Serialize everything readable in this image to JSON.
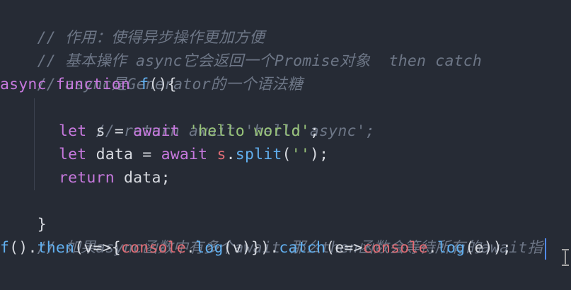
{
  "code": {
    "line1": {
      "comment": "// 作用：使得异步操作更加方便"
    },
    "line2": {
      "comment": "// 基本操作 async它会返回一个Promise对象  then catch"
    },
    "line3": {
      "comment": "// async是Generator的一个语法糖"
    },
    "line4": {
      "kw_async": "async",
      "kw_function": "function",
      "fn_name": "f",
      "rest": "(){"
    },
    "line5": {
      "comment": "// return await 'hello async';"
    },
    "line6": {
      "kw_let": "let",
      "ident": " s = ",
      "kw_await": "await",
      "str": "'hello world'",
      "end": ";"
    },
    "line7": {
      "kw_let": "let",
      "ident": " data = ",
      "kw_await": "await",
      "obj": "s",
      "dot": ".",
      "method": "split",
      "open": "(",
      "str": "''",
      "close": ");"
    },
    "line8": {
      "kw_return": "return",
      "rest": " data;"
    },
    "line9": {
      "text": "}"
    },
    "line10": {
      "comment": "// 如果async函数中有多个await 那么then函数会等待所有的await指"
    },
    "line11": {
      "f": "f",
      "p1": "().",
      "then": "then",
      "p2": "(v=>{",
      "console1": "console",
      "dot1": ".",
      "log1": "log",
      "p3": "(v)}).",
      "catch": "catch",
      "p4": "(e=>",
      "console2": "console",
      "dot2": ".",
      "log2": "log",
      "p5": "(e));"
    }
  },
  "colors": {
    "background": "#262B35",
    "comment": "#6D7686",
    "keyword": "#C678DD",
    "function": "#61AFEF",
    "string": "#98C379",
    "variable": "#E06C75",
    "text": "#D7DAE0",
    "cursor": "#528BFF"
  },
  "icons": {
    "mouse_pointer": "text-ibeam-icon"
  }
}
